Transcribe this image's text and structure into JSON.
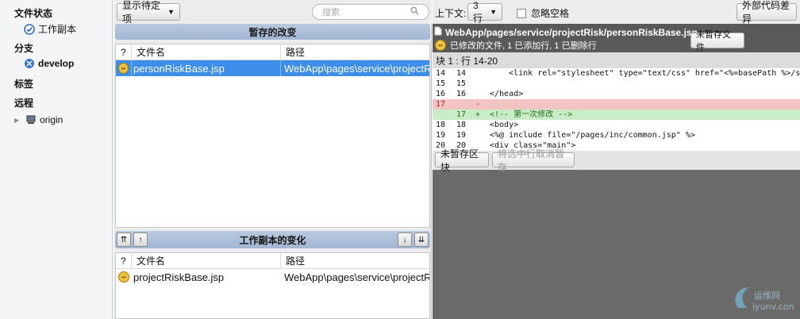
{
  "sidebar": {
    "file_status": "文件状态",
    "working_copy": "工作副本",
    "branches": "分支",
    "current_branch": "develop",
    "tags": "标签",
    "remotes": "远程",
    "remote_origin": "origin"
  },
  "middle": {
    "filter_button": "显示待定项",
    "search_placeholder": "搜索",
    "staged_title": "暂存的改变",
    "unstaged_title": "工作副本的变化",
    "col_status": "?",
    "col_filename": "文件名",
    "col_path": "路径",
    "staged_rows": [
      {
        "name": "personRiskBase.jsp",
        "path": "WebApp\\pages\\service\\projectRisk"
      }
    ],
    "unstaged_rows": [
      {
        "name": "projectRiskBase.jsp",
        "path": "WebApp\\pages\\service\\projectRisk"
      }
    ]
  },
  "right": {
    "context_label": "上下文:",
    "context_value": "3 行",
    "ignore_whitespace": "忽略空格",
    "external_diff": "外部代码差异",
    "file_path": "WebApp/pages/service/projectRisk/personRiskBase.jsp",
    "file_summary": "已修改的文件, 1 已添加行, 1 已删除行",
    "unstage_file": "未暂存文件",
    "hunk_header": "块 1 : 行 14-20",
    "diff_lines": [
      {
        "old": "14",
        "new": "14",
        "mark": "",
        "text": "    <link rel=\"stylesheet\" type=\"text/css\" href=\"<%=basePath %>/s",
        "kind": "ctx"
      },
      {
        "old": "15",
        "new": "15",
        "mark": "",
        "text": "",
        "kind": "ctx"
      },
      {
        "old": "16",
        "new": "16",
        "mark": "",
        "text": "</head>",
        "kind": "ctx"
      },
      {
        "old": "17",
        "new": "",
        "mark": "-",
        "text": "",
        "kind": "del"
      },
      {
        "old": "",
        "new": "17",
        "mark": "+",
        "text": "<!-- 第一次修改 -->",
        "kind": "add"
      },
      {
        "old": "18",
        "new": "18",
        "mark": "",
        "text": "<body>",
        "kind": "ctx"
      },
      {
        "old": "19",
        "new": "19",
        "mark": "",
        "text": "<%@ include file=\"/pages/inc/common.jsp\" %>",
        "kind": "ctx"
      },
      {
        "old": "20",
        "new": "20",
        "mark": "",
        "text": "<div class=\"main\">",
        "kind": "ctx"
      }
    ],
    "unstage_hunk": "未暂存区块",
    "unstage_selected": "将选中行取消暂存"
  }
}
